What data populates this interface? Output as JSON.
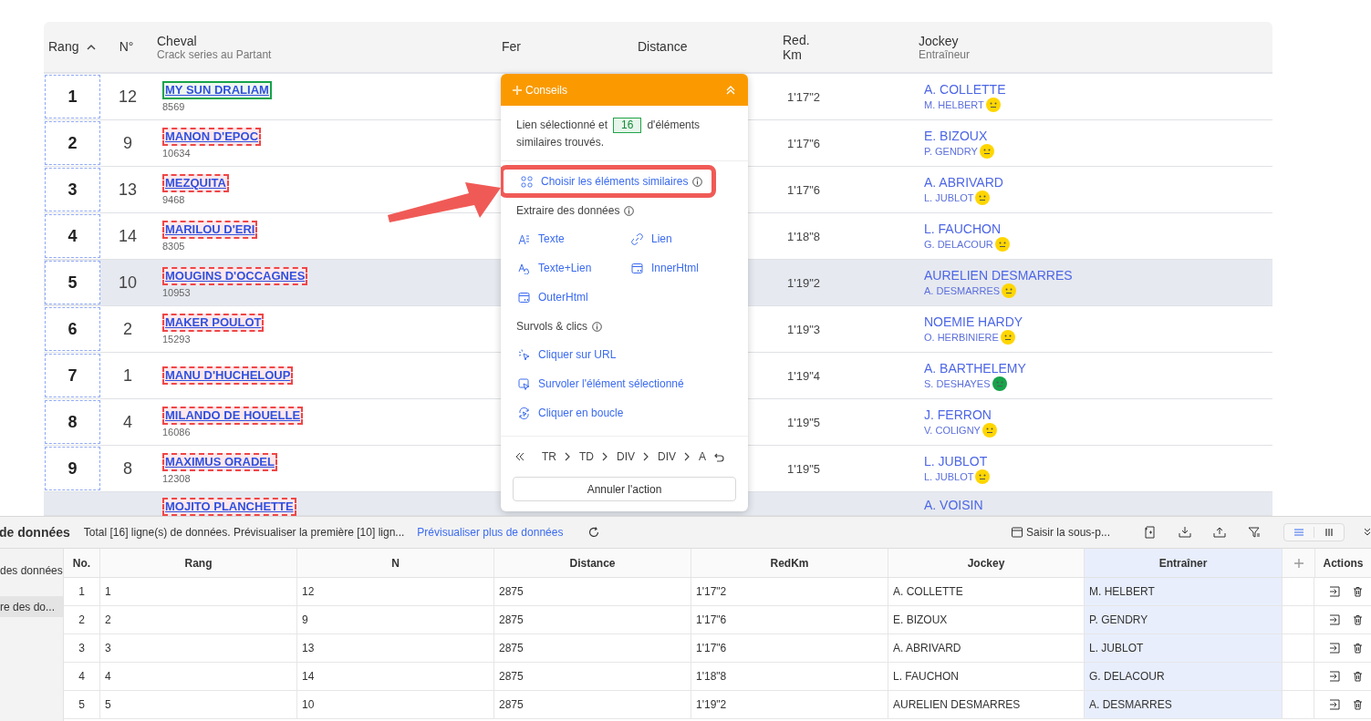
{
  "race_table": {
    "header": {
      "rank": {
        "label": "Rang",
        "sort_ascending": true
      },
      "number": {
        "label": "N°"
      },
      "horse": {
        "label": "Cheval",
        "sublabel": "Crack series au Partant"
      },
      "shoe": {
        "label": "Fer"
      },
      "distance": {
        "label": "Distance"
      },
      "red_km": {
        "label": "Red. Km"
      },
      "jockey": {
        "label": "Jockey",
        "sublabel": "Entraîneur"
      }
    },
    "rows": [
      {
        "rank": "1",
        "number": "12",
        "horse": "MY SUN DRALIAM",
        "horse_id": "8569",
        "selected": true,
        "highlighted": false,
        "red_km": "1'17\"2",
        "jockey": "A. COLLETTE",
        "trainer": "M. HELBERT",
        "color": "#ffd600"
      },
      {
        "rank": "2",
        "number": "9",
        "horse": "MANON D'EPOC",
        "horse_id": "10634",
        "selected": false,
        "highlighted": false,
        "red_km": "1'17\"6",
        "jockey": "E. BIZOUX",
        "trainer": "P. GENDRY",
        "color": "#ffd600"
      },
      {
        "rank": "3",
        "number": "13",
        "horse": "MEZQUITA",
        "horse_id": "9468",
        "selected": false,
        "highlighted": false,
        "red_km": "1'17\"6",
        "jockey": "A. ABRIVARD",
        "trainer": "L. JUBLOT",
        "color": "#ffd600"
      },
      {
        "rank": "4",
        "number": "14",
        "horse": "MARILOU D'ERI",
        "horse_id": "8305",
        "selected": false,
        "highlighted": false,
        "red_km": "1'18\"8",
        "jockey": "L. FAUCHON",
        "trainer": "G. DELACOUR",
        "color": "#ffd600"
      },
      {
        "rank": "5",
        "number": "10",
        "horse": "MOUGINS D'OCCAGNES",
        "horse_id": "10953",
        "selected": false,
        "highlighted": true,
        "red_km": "1'19\"2",
        "jockey": "AURELIEN DESMARRES",
        "trainer": "A. DESMARRES",
        "color": "#ffd600"
      },
      {
        "rank": "6",
        "number": "2",
        "horse": "MAKER POULOT",
        "horse_id": "15293",
        "selected": false,
        "highlighted": false,
        "red_km": "1'19\"3",
        "jockey": "NOEMIE HARDY",
        "trainer": "O. HERBINIERE",
        "color": "#ffd600"
      },
      {
        "rank": "7",
        "number": "1",
        "horse": "MANU D'HUCHELOUP",
        "selected": false,
        "highlighted": false,
        "red_km": "1'19\"4",
        "jockey": "A. BARTHELEMY",
        "trainer": "S. DESHAYES",
        "color": "#16a34a"
      },
      {
        "rank": "8",
        "number": "4",
        "horse": "MILANDO DE HOUELLE",
        "horse_id": "16086",
        "selected": false,
        "highlighted": false,
        "red_km": "1'19\"5",
        "jockey": "J. FERRON",
        "trainer": "V. COLIGNY",
        "color": "#ffd600"
      },
      {
        "rank": "9",
        "number": "8",
        "horse": "MAXIMUS ORADEL",
        "horse_id": "12308",
        "selected": false,
        "highlighted": false,
        "red_km": "1'19\"5",
        "jockey": "L. JUBLOT",
        "trainer": "L. JUBLOT",
        "color": "#ffd600"
      },
      {
        "horse": "MOJITO PLANCHETTE",
        "selected": false,
        "highlighted": true,
        "jockey": "A. VOISIN"
      }
    ]
  },
  "tips_panel": {
    "title": "Conseils",
    "message": "Lien sélectionné et",
    "count": "16",
    "message_end": "d'éléments",
    "message_tail": "similaires trouvés.",
    "primary_action": {
      "label": "Choisir les éléments similaires"
    },
    "sections": [
      {
        "title": "Extraire des données",
        "kind": "grid",
        "items": [
          {
            "label": "Texte"
          },
          {
            "label": "Lien"
          },
          {
            "label": "Texte+Lien"
          },
          {
            "label": "InnerHtml"
          },
          {
            "label": "OuterHtml"
          }
        ]
      },
      {
        "title": "Survols & clics",
        "kind": "list",
        "items": [
          {
            "label": "Cliquer sur URL"
          },
          {
            "label": "Survoler l'élément sélectionné"
          },
          {
            "label": "Cliquer en boucle"
          }
        ]
      }
    ],
    "breadcrumb": [
      "TR",
      "TD",
      "DIV",
      "DIV",
      "A"
    ],
    "cancel_button": "Annuler l'action"
  },
  "data_panel": {
    "title": "de données",
    "summary": "Total [16] ligne(s) de données. Prévisualiser la première [10] lign...",
    "more_link": "Prévisualiser plus de données",
    "subpage_button": "Saisir la sous-p...",
    "list_view_selected": true,
    "sidebar": [
      {
        "label": "des données",
        "selected": false
      },
      {
        "label": "re des do...",
        "selected": true
      }
    ],
    "columns": [
      {
        "label": "No.",
        "selected": false
      },
      {
        "label": "Rang",
        "selected": false
      },
      {
        "label": "N",
        "selected": false
      },
      {
        "label": "Distance",
        "selected": false
      },
      {
        "label": "RedKm",
        "selected": false
      },
      {
        "label": "Jockey",
        "selected": false
      },
      {
        "label": "Entraîner",
        "selected": true
      }
    ],
    "actions_label": "Actions",
    "rows": [
      [
        "1",
        "1",
        "12",
        "2875",
        "1'17\"2",
        "A. COLLETTE",
        "M. HELBERT"
      ],
      [
        "2",
        "2",
        "9",
        "2875",
        "1'17\"6",
        "E. BIZOUX",
        "P. GENDRY"
      ],
      [
        "3",
        "3",
        "13",
        "2875",
        "1'17\"6",
        "A. ABRIVARD",
        "L. JUBLOT"
      ],
      [
        "4",
        "4",
        "14",
        "2875",
        "1'18\"8",
        "L. FAUCHON",
        "G. DELACOUR"
      ],
      [
        "5",
        "5",
        "10",
        "2875",
        "1'19\"2",
        "AURELIEN DESMARRES",
        "A. DESMARRES"
      ]
    ]
  }
}
